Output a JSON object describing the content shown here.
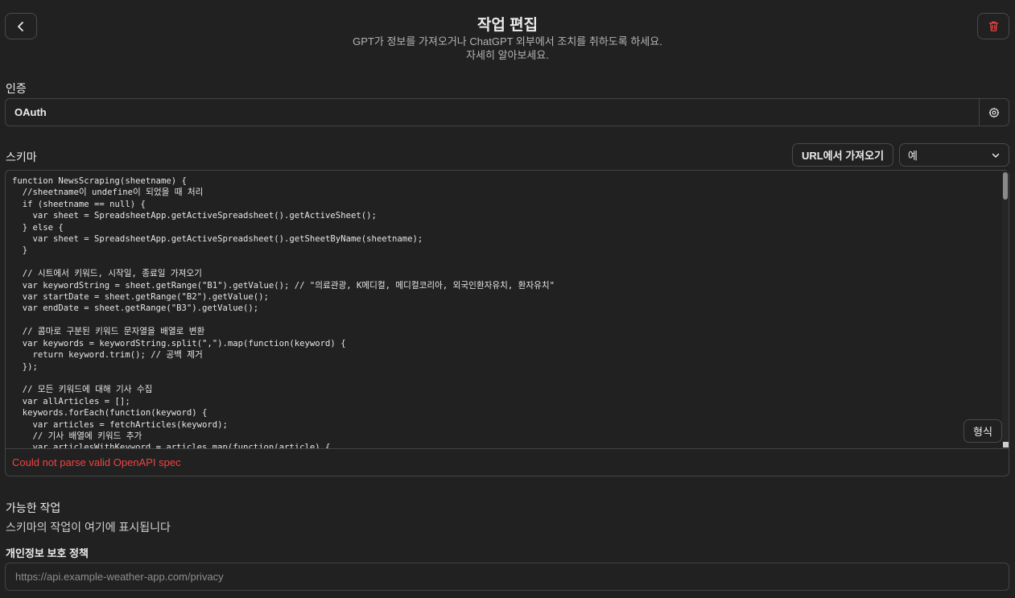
{
  "header": {
    "title": "작업 편집",
    "subtitle_line1": "GPT가 정보를 가져오거나 ChatGPT 외부에서 조치를 취하도록 하세요.",
    "subtitle_line2": "자세히 알아보세요.",
    "back_icon": "chevron-left-icon",
    "delete_icon": "trash-icon",
    "delete_color": "#ef4444"
  },
  "auth": {
    "label": "인증",
    "value": "OAuth",
    "settings_icon": "gear-icon"
  },
  "schema": {
    "label": "스키마",
    "import_button": "URL에서 가져오기",
    "example_select": "예",
    "format_button": "형식",
    "error": "Could not parse valid OpenAPI spec",
    "error_color": "#ef4444",
    "code": "function NewsScraping(sheetname) {\n  //sheetname이 undefine이 되었을 때 처리\n  if (sheetname == null) {\n    var sheet = SpreadsheetApp.getActiveSpreadsheet().getActiveSheet();\n  } else {\n    var sheet = SpreadsheetApp.getActiveSpreadsheet().getSheetByName(sheetname);\n  }\n\n  // 시트에서 키워드, 시작일, 종료일 가져오기\n  var keywordString = sheet.getRange(\"B1\").getValue(); // \"의료관광, K메디컬, 메디컬코리아, 외국인환자유치, 환자유치\"\n  var startDate = sheet.getRange(\"B2\").getValue();\n  var endDate = sheet.getRange(\"B3\").getValue();\n\n  // 콤마로 구분된 키워드 문자열을 배열로 변환\n  var keywords = keywordString.split(\",\").map(function(keyword) {\n    return keyword.trim(); // 공백 제거\n  });\n\n  // 모든 키워드에 대해 기사 수집\n  var allArticles = [];\n  keywords.forEach(function(keyword) {\n    var articles = fetchArticles(keyword);\n    // 기사 배열에 키워드 추가\n    var articlesWithKeyword = articles.map(function(article) {"
  },
  "actions": {
    "label": "가능한 작업",
    "empty_text": "스키마의 작업이 여기에 표시됩니다"
  },
  "privacy": {
    "label": "개인정보 보호 정책",
    "placeholder": "https://api.example-weather-app.com/privacy"
  }
}
